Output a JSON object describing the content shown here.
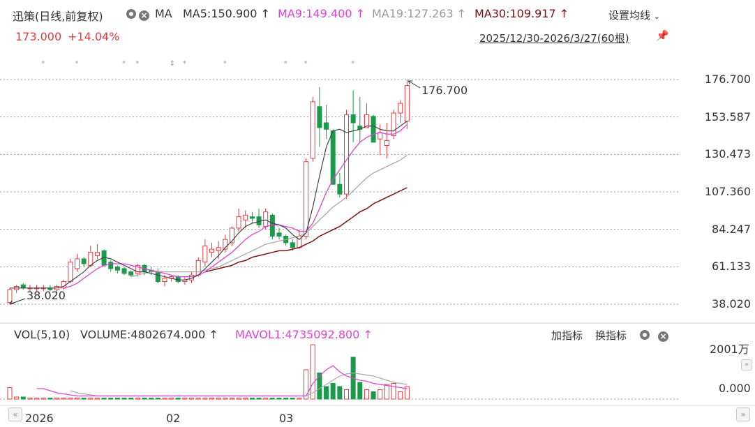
{
  "header": {
    "stock_label": "迅策(日线,前复权)",
    "ma_label": "MA",
    "ma5": "MA5:150.900",
    "ma9": "MA9:149.400",
    "ma19": "MA19:127.263",
    "ma30": "MA30:109.917",
    "arrow": "↑",
    "settings_label": "设置均线",
    "price": "173.000",
    "change": "+14.04%",
    "range": "2025/12/30-2026/3/27(60根)"
  },
  "price_axis": [
    "176.700",
    "153.587",
    "130.473",
    "107.360",
    "84.247",
    "61.133",
    "38.020"
  ],
  "annotations": {
    "high": "176.700",
    "low": "38.020"
  },
  "volume_header": {
    "vol_label": "VOL(5,10)",
    "volume": "VOLUME:4802674.000",
    "arrow": "↑",
    "mavol1": "MAVOL1:4735092.800",
    "add_indicator": "加指标",
    "switch_indicator": "换指标"
  },
  "volume_axis": [
    "2001万",
    "0.000"
  ],
  "date_axis": [
    "2026",
    "02",
    "03"
  ],
  "event_markers": [
    "*",
    "*",
    "*",
    "*",
    "↕",
    "*",
    "*",
    "*",
    "*",
    "*"
  ],
  "colors": {
    "up": "#e8383c",
    "down": "#1a9a4a",
    "ma5": "#444444",
    "ma9": "#e040d8",
    "ma19": "#a8a8a8",
    "ma30": "#7a1010"
  },
  "chart_data": {
    "type": "candlestick",
    "ylim": [
      38.02,
      176.7
    ],
    "candles": [
      {
        "o": 39,
        "h": 48,
        "l": 38.02,
        "c": 47
      },
      {
        "o": 47,
        "h": 50,
        "l": 45,
        "c": 49
      },
      {
        "o": 50,
        "h": 51,
        "l": 47,
        "c": 48
      },
      {
        "o": 48,
        "h": 50,
        "l": 46,
        "c": 48
      },
      {
        "o": 48,
        "h": 50,
        "l": 46,
        "c": 48
      },
      {
        "o": 48,
        "h": 50,
        "l": 46,
        "c": 48
      },
      {
        "o": 48,
        "h": 50,
        "l": 46,
        "c": 47
      },
      {
        "o": 47,
        "h": 50,
        "l": 45,
        "c": 49
      },
      {
        "o": 48,
        "h": 53,
        "l": 47,
        "c": 52
      },
      {
        "o": 52,
        "h": 66,
        "l": 51,
        "c": 64
      },
      {
        "o": 60,
        "h": 69,
        "l": 58,
        "c": 66
      },
      {
        "o": 66,
        "h": 67,
        "l": 61,
        "c": 63
      },
      {
        "o": 62,
        "h": 74,
        "l": 61,
        "c": 70
      },
      {
        "o": 68,
        "h": 75,
        "l": 66,
        "c": 70
      },
      {
        "o": 71,
        "h": 72,
        "l": 61,
        "c": 62
      },
      {
        "o": 64,
        "h": 65,
        "l": 58,
        "c": 60
      },
      {
        "o": 61,
        "h": 62,
        "l": 57,
        "c": 59
      },
      {
        "o": 60,
        "h": 61,
        "l": 56,
        "c": 57
      },
      {
        "o": 58,
        "h": 59,
        "l": 55,
        "c": 56
      },
      {
        "o": 57,
        "h": 63,
        "l": 55,
        "c": 62
      },
      {
        "o": 62,
        "h": 63,
        "l": 56,
        "c": 58
      },
      {
        "o": 59,
        "h": 61,
        "l": 56,
        "c": 58
      },
      {
        "o": 58,
        "h": 60,
        "l": 51,
        "c": 52
      },
      {
        "o": 52,
        "h": 56,
        "l": 49,
        "c": 54
      },
      {
        "o": 54,
        "h": 56,
        "l": 52,
        "c": 55
      },
      {
        "o": 55,
        "h": 56,
        "l": 51,
        "c": 52
      },
      {
        "o": 52,
        "h": 55,
        "l": 50,
        "c": 53
      },
      {
        "o": 53,
        "h": 58,
        "l": 51,
        "c": 56
      },
      {
        "o": 56,
        "h": 67,
        "l": 55,
        "c": 65
      },
      {
        "o": 64,
        "h": 78,
        "l": 61,
        "c": 74
      },
      {
        "o": 70,
        "h": 76,
        "l": 67,
        "c": 72
      },
      {
        "o": 71,
        "h": 77,
        "l": 66,
        "c": 73
      },
      {
        "o": 72,
        "h": 81,
        "l": 70,
        "c": 78
      },
      {
        "o": 76,
        "h": 86,
        "l": 74,
        "c": 85
      },
      {
        "o": 85,
        "h": 97,
        "l": 83,
        "c": 92
      },
      {
        "o": 90,
        "h": 96,
        "l": 85,
        "c": 93
      },
      {
        "o": 92,
        "h": 95,
        "l": 88,
        "c": 91
      },
      {
        "o": 92,
        "h": 97,
        "l": 85,
        "c": 87
      },
      {
        "o": 86,
        "h": 97,
        "l": 84,
        "c": 95
      },
      {
        "o": 93,
        "h": 94,
        "l": 78,
        "c": 80
      },
      {
        "o": 82,
        "h": 85,
        "l": 78,
        "c": 80
      },
      {
        "o": 80,
        "h": 81,
        "l": 74,
        "c": 76
      },
      {
        "o": 76,
        "h": 78,
        "l": 71,
        "c": 73
      },
      {
        "o": 73,
        "h": 84,
        "l": 72,
        "c": 80
      },
      {
        "o": 80,
        "h": 128,
        "l": 78,
        "c": 126
      },
      {
        "o": 128,
        "h": 166,
        "l": 126,
        "c": 163
      },
      {
        "o": 160,
        "h": 172,
        "l": 135,
        "c": 147
      },
      {
        "o": 150,
        "h": 161,
        "l": 140,
        "c": 146
      },
      {
        "o": 145,
        "h": 146,
        "l": 120,
        "c": 112
      },
      {
        "o": 112,
        "h": 119,
        "l": 104,
        "c": 106
      },
      {
        "o": 106,
        "h": 158,
        "l": 103,
        "c": 155
      },
      {
        "o": 155,
        "h": 170,
        "l": 138,
        "c": 150
      },
      {
        "o": 148,
        "h": 166,
        "l": 138,
        "c": 146
      },
      {
        "o": 147,
        "h": 162,
        "l": 148,
        "c": 155
      },
      {
        "o": 154,
        "h": 155,
        "l": 143,
        "c": 138
      },
      {
        "o": 140,
        "h": 149,
        "l": 130,
        "c": 144
      },
      {
        "o": 136,
        "h": 150,
        "l": 128,
        "c": 139
      },
      {
        "o": 142,
        "h": 158,
        "l": 140,
        "c": 156
      },
      {
        "o": 156,
        "h": 164,
        "l": 150,
        "c": 162
      },
      {
        "o": 151,
        "h": 176.7,
        "l": 146,
        "c": 173
      }
    ],
    "ma5": [
      48,
      48,
      48,
      48,
      48,
      48,
      48,
      48,
      49,
      52,
      55,
      58,
      62,
      65,
      67,
      66,
      64,
      62,
      60,
      58,
      58,
      57,
      56,
      55,
      54,
      53,
      53,
      54,
      56,
      60,
      64,
      68,
      73,
      77,
      82,
      86,
      88,
      89,
      90,
      88,
      87,
      85,
      81,
      78,
      82,
      98,
      117,
      135,
      145,
      146,
      144,
      145,
      146,
      148,
      148,
      146,
      145,
      145,
      148,
      151
    ],
    "ma9": [
      null,
      null,
      null,
      null,
      null,
      null,
      null,
      null,
      48,
      49,
      51,
      54,
      57,
      60,
      62,
      63,
      63,
      63,
      62,
      61,
      60,
      59,
      58,
      57,
      56,
      55,
      55,
      55,
      56,
      58,
      61,
      64,
      67,
      70,
      74,
      78,
      81,
      83,
      86,
      87,
      87,
      86,
      85,
      83,
      83,
      88,
      97,
      107,
      115,
      121,
      127,
      133,
      138,
      141,
      143,
      144,
      143,
      143,
      145,
      149
    ],
    "ma19": [
      null,
      null,
      null,
      null,
      null,
      null,
      null,
      null,
      null,
      null,
      null,
      null,
      null,
      null,
      null,
      null,
      null,
      null,
      55,
      56,
      57,
      58,
      58,
      58,
      58,
      58,
      58,
      58,
      58,
      59,
      60,
      61,
      63,
      65,
      67,
      69,
      71,
      73,
      75,
      76,
      77,
      78,
      79,
      80,
      82,
      86,
      90,
      94,
      98,
      101,
      104,
      108,
      112,
      116,
      119,
      121,
      123,
      125,
      127,
      130
    ],
    "ma30": [
      null,
      null,
      null,
      null,
      null,
      null,
      null,
      null,
      null,
      null,
      null,
      null,
      null,
      null,
      null,
      null,
      null,
      null,
      null,
      null,
      null,
      null,
      null,
      null,
      null,
      null,
      null,
      null,
      null,
      58,
      59,
      60,
      61,
      62,
      64,
      65,
      67,
      68,
      69,
      70,
      71,
      71,
      72,
      73,
      75,
      77,
      80,
      82,
      84,
      86,
      89,
      92,
      95,
      97,
      100,
      102,
      104,
      106,
      108,
      110
    ],
    "volume": [
      11,
      2,
      2,
      1,
      1,
      1,
      1,
      1,
      1,
      1,
      1,
      1,
      1,
      1,
      1,
      1,
      1,
      1,
      1,
      1,
      1,
      1,
      1,
      1,
      1,
      1,
      1,
      1,
      1,
      1,
      1,
      1,
      1,
      1,
      1,
      1,
      1,
      1,
      1,
      1,
      1,
      1,
      1,
      1,
      28,
      52,
      25,
      12,
      15,
      12,
      9,
      40,
      16,
      9,
      7,
      9,
      14,
      15,
      7,
      12
    ],
    "mavol1": [
      null,
      null,
      null,
      null,
      10,
      10,
      8,
      6,
      5,
      4,
      3,
      3,
      3,
      3,
      3,
      3,
      3,
      3,
      3,
      3,
      3,
      3,
      3,
      3,
      3,
      3,
      3,
      3,
      3,
      3,
      3,
      3,
      3,
      3,
      3,
      3,
      3,
      3,
      3,
      3,
      3,
      3,
      3,
      3,
      3,
      15,
      22,
      28,
      32,
      26,
      22,
      20,
      18,
      17,
      15,
      14,
      13,
      12,
      11,
      10
    ],
    "mavol2": [
      null,
      null,
      null,
      null,
      null,
      null,
      null,
      null,
      null,
      8,
      6,
      5,
      4,
      3,
      3,
      3,
      3,
      3,
      3,
      3,
      3,
      3,
      3,
      3,
      3,
      3,
      3,
      3,
      3,
      3,
      3,
      3,
      3,
      3,
      3,
      3,
      3,
      3,
      3,
      3,
      3,
      3,
      3,
      3,
      3,
      6,
      10,
      14,
      18,
      22,
      24,
      25,
      24,
      23,
      22,
      20,
      18,
      16,
      15,
      14
    ]
  }
}
